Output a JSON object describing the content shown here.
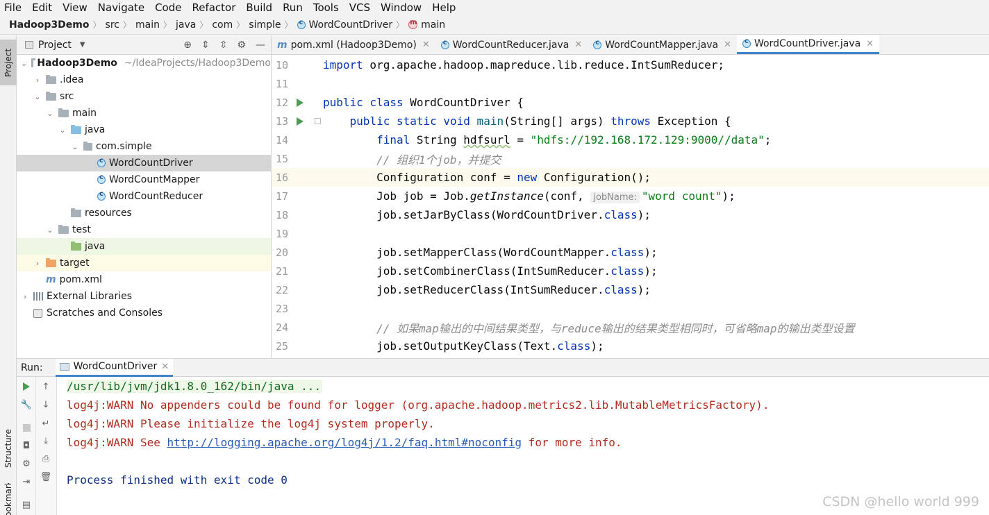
{
  "menu": [
    "File",
    "Edit",
    "View",
    "Navigate",
    "Code",
    "Refactor",
    "Build",
    "Run",
    "Tools",
    "VCS",
    "Window",
    "Help"
  ],
  "breadcrumb": [
    "Hadoop3Demo",
    "src",
    "main",
    "java",
    "com",
    "simple",
    "WordCountDriver",
    "main"
  ],
  "left_strip": {
    "project": "Project",
    "structure": "Structure",
    "bookmarks": "Bookmarks"
  },
  "project_panel": {
    "title": "Project",
    "tree": {
      "root": "Hadoop3Demo",
      "root_path": "~/IdeaProjects/Hadoop3Demo",
      "idea": ".idea",
      "src": "src",
      "main": "main",
      "java": "java",
      "package": "com.simple",
      "class1": "WordCountDriver",
      "class2": "WordCountMapper",
      "class3": "WordCountReducer",
      "resources": "resources",
      "test": "test",
      "test_java": "java",
      "target": "target",
      "pom": "pom.xml",
      "external": "External Libraries",
      "scratches": "Scratches and Consoles"
    }
  },
  "editor_tabs": [
    {
      "label": "pom.xml (Hadoop3Demo)",
      "icon": "maven-icon",
      "active": false
    },
    {
      "label": "WordCountReducer.java",
      "icon": "class-icon",
      "active": false
    },
    {
      "label": "WordCountMapper.java",
      "icon": "class-icon",
      "active": false
    },
    {
      "label": "WordCountDriver.java",
      "icon": "class-icon",
      "active": true
    }
  ],
  "code": {
    "line_numbers": [
      "10",
      "11",
      "12",
      "13",
      "14",
      "15",
      "16",
      "17",
      "18",
      "19",
      "20",
      "21",
      "22",
      "23",
      "24",
      "25"
    ],
    "l10_kw": "import",
    "l10_rest": " org.apache.hadoop.mapreduce.lib.reduce.IntSumReducer;",
    "l12_kw": "public class",
    "l12_rest": " WordCountDriver {",
    "l13_kw1": "    public static void",
    "l13_fn": " main",
    "l13_mid": "(String[] args) ",
    "l13_kw2": "throws",
    "l13_rest": " Exception {",
    "l14_kw": "        final",
    "l14_mid": " String ",
    "l14_var": "hdfsurl",
    "l14_eq": " = ",
    "l14_str": "\"hdfs://192.168.172.129:9000//data\"",
    "l14_end": ";",
    "l15_cmt": "        // 组织1个job，并提交",
    "l16_pre": "        Configuration conf = ",
    "l16_kw": "new",
    "l16_rest": " Configuration();",
    "l17_pre": "        Job job = Job.",
    "l17_it": "getInstance",
    "l17_mid": "(conf, ",
    "l17_hint": "jobName:",
    "l17_str": "\"word count\"",
    "l17_end": ");",
    "l18_pre": "        job.setJarByClass(WordCountDriver.",
    "l18_kw": "class",
    "l18_end": ");",
    "l20_pre": "        job.setMapperClass(WordCountMapper.",
    "l20_kw": "class",
    "l20_end": ");",
    "l21_pre": "        job.setCombinerClass(IntSumReducer.",
    "l21_kw": "class",
    "l21_end": ");",
    "l22_pre": "        job.setReducerClass(IntSumReducer.",
    "l22_kw": "class",
    "l22_end": ");",
    "l24_cmt": "        // 如果map输出的中间结果类型，与reduce输出的结果类型相同时，可省略map的输出类型设置",
    "l25_pre": "        job.setOutputKeyClass(Text.",
    "l25_kw": "class",
    "l25_end": ");"
  },
  "run_panel": {
    "label": "Run:",
    "tab": "WordCountDriver",
    "console": {
      "cmd": "/usr/lib/jvm/jdk1.8.0_162/bin/java ...",
      "warn1": "log4j:WARN No appenders could be found for logger (org.apache.hadoop.metrics2.lib.MutableMetricsFactory).",
      "warn2": "log4j:WARN Please initialize the log4j system properly.",
      "warn3_pre": "log4j:WARN See ",
      "warn3_link": "http://logging.apache.org/log4j/1.2/faq.html#noconfig",
      "warn3_post": " for more info.",
      "exit": "Process finished with exit code 0"
    }
  },
  "watermark": "CSDN @hello world 999",
  "colors": {
    "accent": "#4083c9",
    "run_green": "#499c54",
    "warn_red": "#b52a1d",
    "keyword": "#0033b3",
    "string": "#067d17"
  }
}
